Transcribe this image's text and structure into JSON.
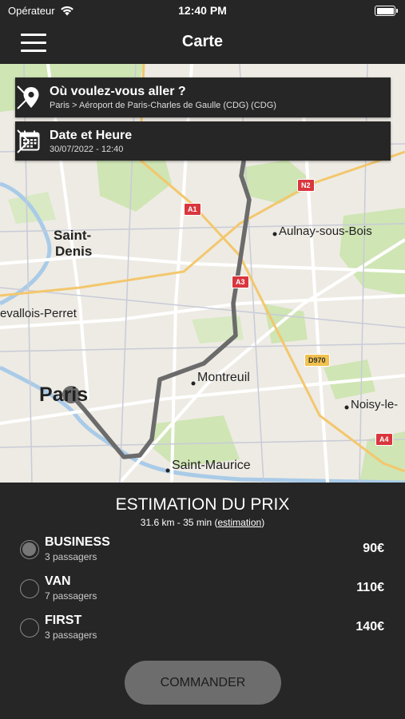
{
  "status": {
    "carrier": "Opérateur",
    "time": "12:40 PM"
  },
  "nav": {
    "title": "Carte"
  },
  "destination": {
    "title": "Où voulez-vous aller ?",
    "subtitle": "Paris > Aéroport de Paris-Charles de Gaulle (CDG) (CDG)"
  },
  "datetime": {
    "title": "Date et Heure",
    "value": "30/07/2022 - 12:40"
  },
  "map": {
    "places": {
      "saint_denis_1": "Saint-",
      "saint_denis_2": "Denis",
      "aulnay": "Aulnay-sous-Bois",
      "levallois": "evallois-Perret",
      "montreuil": "Montreuil",
      "paris": "Paris",
      "noisy": "Noisy-le-",
      "saint_maurice": "Saint-Maurice"
    },
    "shields": {
      "a1": "A1",
      "a3": "A3",
      "n2": "N2",
      "d970": "D970",
      "a4": "A4"
    }
  },
  "estimate": {
    "title": "ESTIMATION DU PRIX",
    "distance_time": "31.6 km - 35 min",
    "link": "estimation",
    "open_paren": "(",
    "close_paren": ")"
  },
  "options": [
    {
      "name": "BUSINESS",
      "pax": "3 passagers",
      "price": "90€",
      "selected": true
    },
    {
      "name": "VAN",
      "pax": "7 passagers",
      "price": "110€",
      "selected": false
    },
    {
      "name": "FIRST",
      "pax": "3 passagers",
      "price": "140€",
      "selected": false
    }
  ],
  "order_button": "COMMANDER",
  "colors": {
    "background": "#262626",
    "route": "#6b6b6b",
    "button": "#6d6d6d",
    "shield_red": "#d9363e"
  }
}
